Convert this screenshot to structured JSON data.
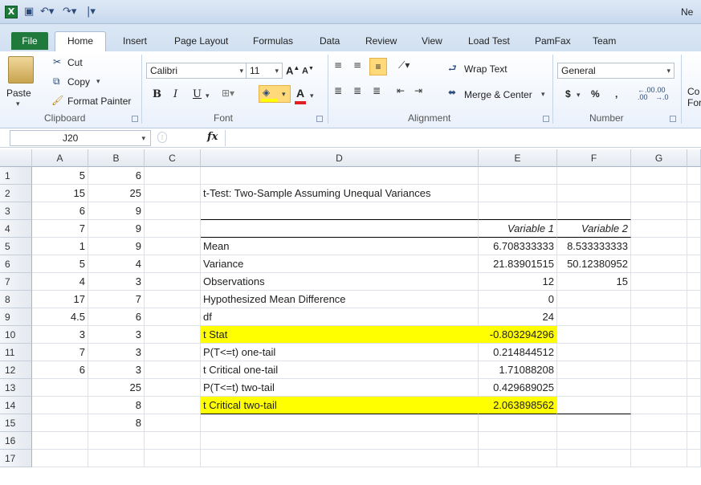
{
  "window": {
    "app_logo": "X",
    "title": "Ne",
    "quick_access": [
      "save-icon",
      "undo-icon",
      "redo-icon",
      "customize-icon"
    ]
  },
  "tabs": [
    "File",
    "Home",
    "Insert",
    "Page Layout",
    "Formulas",
    "Data",
    "Review",
    "View",
    "Load Test",
    "PamFax",
    "Team"
  ],
  "ribbon": {
    "clipboard": {
      "paste": "Paste",
      "cut": "Cut",
      "copy": "Copy",
      "format_painter": "Format Painter",
      "label": "Clipboard"
    },
    "font": {
      "name": "Calibri",
      "size": "11",
      "bold": "B",
      "italic": "I",
      "underline": "U",
      "font_color": "A",
      "label": "Font"
    },
    "alignment": {
      "wrap_text": "Wrap Text",
      "merge_center": "Merge & Center",
      "label": "Alignment"
    },
    "number": {
      "format": "General",
      "currency": "$",
      "percent": "%",
      "comma": ",",
      "inc_decimal": ".00",
      "dec_decimal": ".0",
      "label": "Number"
    },
    "styles": {
      "cond_format_1": "Co",
      "cond_format_2": "For"
    }
  },
  "formula_bar": {
    "name_box": "J20",
    "fx": "fx",
    "formula": ""
  },
  "columns": [
    "A",
    "B",
    "C",
    "D",
    "E",
    "F",
    "G"
  ],
  "rows": [
    "1",
    "2",
    "3",
    "4",
    "5",
    "6",
    "7",
    "8",
    "9",
    "10",
    "11",
    "12",
    "13",
    "14",
    "15",
    "16",
    "17"
  ],
  "cells": {
    "A": [
      "5",
      "15",
      "6",
      "7",
      "1",
      "5",
      "4",
      "17",
      "4.5",
      "3",
      "7",
      "6",
      "",
      "",
      "",
      "",
      ""
    ],
    "B": [
      "6",
      "25",
      "9",
      "9",
      "9",
      "4",
      "3",
      "7",
      "6",
      "3",
      "3",
      "3",
      "25",
      "8",
      "8",
      "",
      ""
    ],
    "D": [
      "",
      "t-Test: Two-Sample Assuming Unequal Variances",
      "",
      "",
      "Mean",
      "Variance",
      "Observations",
      "Hypothesized Mean Difference",
      "df",
      "t Stat",
      "P(T<=t) one-tail",
      "t Critical one-tail",
      "P(T<=t) two-tail",
      "t Critical two-tail",
      "",
      "",
      ""
    ],
    "E": [
      "",
      "",
      "",
      "Variable 1",
      "6.708333333",
      "21.83901515",
      "12",
      "0",
      "24",
      "-0.803294296",
      "0.214844512",
      "1.71088208",
      "0.429689025",
      "2.063898562",
      "",
      "",
      ""
    ],
    "F": [
      "",
      "",
      "",
      "Variable 2",
      "8.533333333",
      "50.12380952",
      "15",
      "",
      "",
      "",
      "",
      "",
      "",
      "",
      "",
      "",
      ""
    ]
  },
  "colors": {
    "highlight": "#ffff00",
    "file_tab": "#1f7a3c"
  }
}
